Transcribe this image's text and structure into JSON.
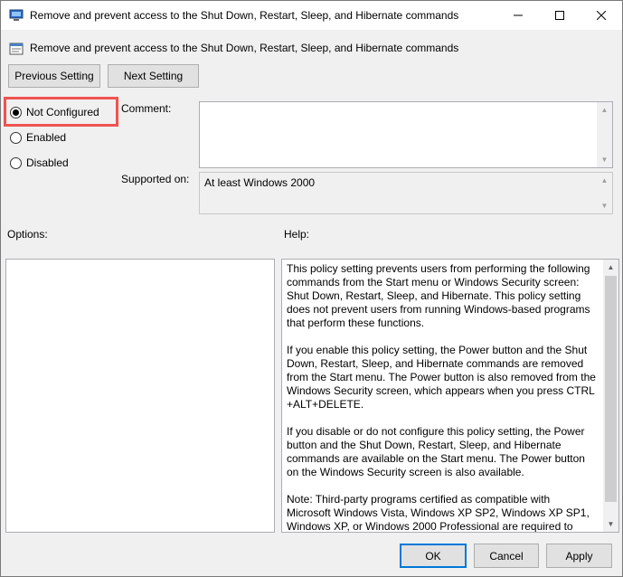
{
  "window": {
    "title": "Remove and prevent access to the Shut Down, Restart, Sleep, and Hibernate commands"
  },
  "header": {
    "title": "Remove and prevent access to the Shut Down, Restart, Sleep, and Hibernate commands"
  },
  "nav": {
    "previous_label": "Previous Setting",
    "next_label": "Next Setting"
  },
  "state": {
    "options": [
      {
        "label": "Not Configured",
        "selected": true
      },
      {
        "label": "Enabled",
        "selected": false
      },
      {
        "label": "Disabled",
        "selected": false
      }
    ]
  },
  "comment": {
    "label": "Comment:",
    "value": ""
  },
  "supported": {
    "label": "Supported on:",
    "value": "At least Windows 2000"
  },
  "options_label": "Options:",
  "help": {
    "label": "Help:",
    "paragraphs": [
      "This policy setting prevents users from performing the following commands from the Start menu or Windows Security screen: Shut Down, Restart, Sleep, and Hibernate. This policy setting does not prevent users from running Windows-based programs that perform these functions.",
      "If you enable this policy setting, the Power button and the Shut Down, Restart, Sleep, and Hibernate commands are removed from the Start menu. The Power button is also removed from the Windows Security screen, which appears when you press CTRL +ALT+DELETE.",
      "If you disable or do not configure this policy setting, the Power button and the Shut Down, Restart, Sleep, and Hibernate commands are available on the Start menu. The Power button on the Windows Security screen is also available.",
      "Note: Third-party programs certified as compatible with Microsoft Windows Vista, Windows XP SP2, Windows XP SP1, Windows XP, or Windows 2000 Professional are required to"
    ]
  },
  "footer": {
    "ok_label": "OK",
    "cancel_label": "Cancel",
    "apply_label": "Apply"
  },
  "colors": {
    "highlight": "#ef5350",
    "default_button_border": "#0078d7"
  }
}
